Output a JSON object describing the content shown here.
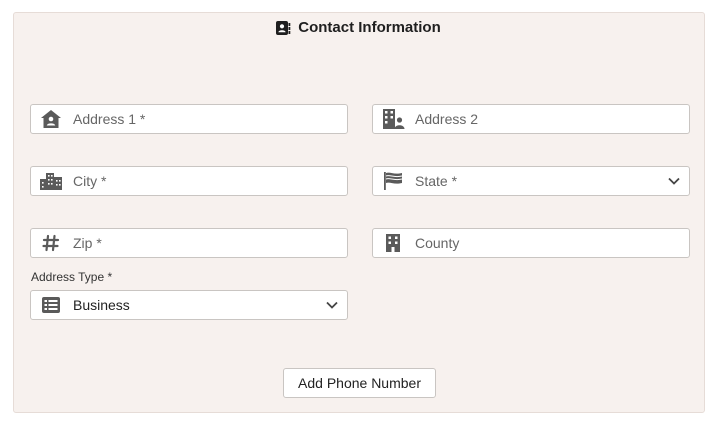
{
  "section": {
    "title": "Contact Information",
    "icon": "contact-card-icon"
  },
  "fields": {
    "address1": {
      "placeholder": "Address 1 *",
      "icon": "home-person-icon"
    },
    "address2": {
      "placeholder": "Address 2",
      "icon": "building-person-icon"
    },
    "city": {
      "placeholder": "City *",
      "icon": "city-icon"
    },
    "state": {
      "placeholder": "State *",
      "icon": "flag-icon"
    },
    "zip": {
      "placeholder": "Zip *",
      "icon": "hash-icon"
    },
    "county": {
      "placeholder": "County",
      "icon": "building-icon"
    },
    "address_type": {
      "label": "Address Type *",
      "value": "Business",
      "icon": "list-icon"
    }
  },
  "buttons": {
    "add_phone": "Add Phone Number"
  },
  "colors": {
    "panel_bg": "#f7f1ee",
    "icon": "#5a5a5a",
    "title_icon": "#1f1f1f"
  }
}
